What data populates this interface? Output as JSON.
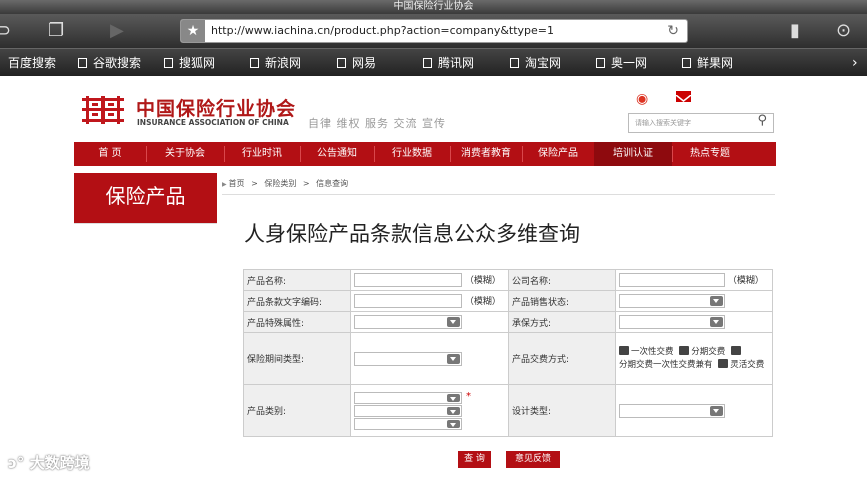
{
  "browser": {
    "window_title": "中国保险行业协会",
    "url": "http://www.iachina.cn/product.php?action=company&ttype=1",
    "bookmarks": [
      "百度搜索",
      "谷歌搜索",
      "搜狐网",
      "新浪网",
      "网易",
      "腾讯网",
      "淘宝网",
      "奥一网",
      "鲜果网"
    ]
  },
  "site": {
    "name_cn": "中国保险行业协会",
    "name_en": "INSURANCE ASSOCIATION OF CHINA",
    "slogan": "自律 维权 服务 交流 宣传",
    "search_placeholder": "请输入搜索关键字",
    "nav": [
      "首 页",
      "关于协会",
      "行业时讯",
      "公告通知",
      "行业数据",
      "消费者教育",
      "保险产品",
      "培训认证",
      "热点专题"
    ],
    "nav_active": "保险产品",
    "brand_color": "#b30f14"
  },
  "sidebar": {
    "title": "保险产品"
  },
  "breadcrumb": {
    "home": "首页",
    "sep1": ">",
    "cat": "保险类别",
    "sep2": ">",
    "current": "信息查询"
  },
  "page_title": "人身保险产品条款信息公众多维查询",
  "form": {
    "product_name": "产品名称:",
    "fuzzy": "（模糊）",
    "company_name": "公司名称:",
    "fuzzy2": "（模糊）",
    "clause_code": "产品条款文字编码:",
    "fuzzy3": "（模糊）",
    "sale_status": "产品销售状态:",
    "special_attr": "产品特殊属性:",
    "underwriting": "承保方式:",
    "period_type": "保险期间类型:",
    "payment_mode": "产品交费方式:",
    "pay_opt1": "一次性交费",
    "pay_opt2": "分期交费",
    "pay_opt3": "分期交费一次性交费兼有",
    "pay_opt4": "灵活交费",
    "category": "产品类别:",
    "required_mark": "*",
    "design_type": "设计类型:"
  },
  "buttons": {
    "query": "查 询",
    "feedback": "意见反馈"
  },
  "watermark": "大数跨境"
}
